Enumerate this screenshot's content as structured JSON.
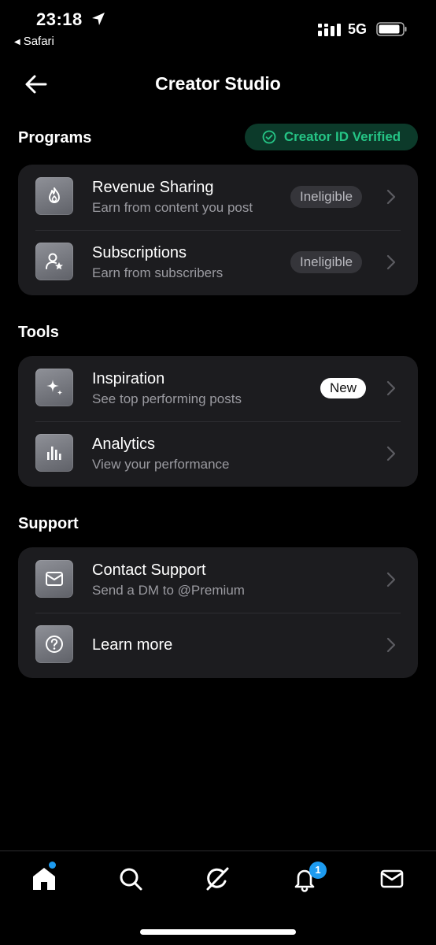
{
  "status_bar": {
    "time": "23:18",
    "back_app": "Safari",
    "network": "5G"
  },
  "header": {
    "title": "Creator Studio"
  },
  "sections": {
    "programs": {
      "title": "Programs",
      "badge": "Creator ID Verified",
      "items": [
        {
          "title": "Revenue Sharing",
          "subtitle": "Earn from content you post",
          "status": "Ineligible",
          "icon": "flame-icon"
        },
        {
          "title": "Subscriptions",
          "subtitle": "Earn from subscribers",
          "status": "Ineligible",
          "icon": "user-star-icon"
        }
      ]
    },
    "tools": {
      "title": "Tools",
      "items": [
        {
          "title": "Inspiration",
          "subtitle": "See top performing posts",
          "status": "New",
          "icon": "sparkle-icon"
        },
        {
          "title": "Analytics",
          "subtitle": "View your performance",
          "icon": "bar-chart-icon"
        }
      ]
    },
    "support": {
      "title": "Support",
      "items": [
        {
          "title": "Contact Support",
          "subtitle": "Send a DM to @Premium",
          "icon": "envelope-icon"
        },
        {
          "title": "Learn more",
          "icon": "question-icon"
        }
      ]
    }
  },
  "tab_bar": {
    "items": [
      "home-icon",
      "search-icon",
      "grok-icon",
      "bell-icon",
      "mail-icon"
    ],
    "notification_count": "1"
  },
  "colors": {
    "accent_green": "#25c485",
    "badge_green_bg": "#0c3a2a",
    "accent_blue": "#1d9bf0",
    "card_bg": "#1c1c1f"
  }
}
